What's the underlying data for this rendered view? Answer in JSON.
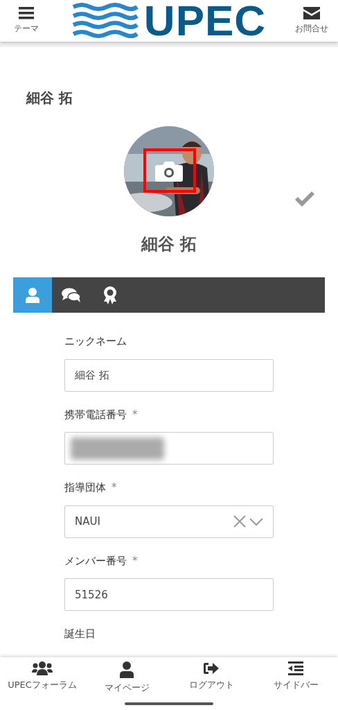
{
  "header": {
    "menu_label": "テーマ",
    "logo_text": "UPEC",
    "contact_label": "お問合せ"
  },
  "profile": {
    "title": "細谷 拓",
    "name": "細谷 拓",
    "saved": true,
    "photo_highlighted": true
  },
  "tabs": [
    {
      "kind": "profile",
      "selected": true
    },
    {
      "kind": "messages",
      "selected": false
    },
    {
      "kind": "awards",
      "selected": false
    }
  ],
  "fields": [
    {
      "kind": "text",
      "label": "ニックネーム",
      "value": "細谷 拓"
    },
    {
      "kind": "redacted",
      "label": "携帯電話番号",
      "required_mark": "*"
    },
    {
      "kind": "select",
      "label": "指導団体",
      "required_mark": "*",
      "value": "NAUI"
    },
    {
      "kind": "text",
      "label": "メンバー番号",
      "required_mark": "*",
      "value": "51526"
    },
    {
      "kind": "label",
      "label": "誕生日"
    }
  ],
  "bottom_nav": [
    {
      "kind": "group",
      "label": "UPECフォーラム"
    },
    {
      "kind": "user",
      "label": "マイページ"
    },
    {
      "kind": "logout",
      "label": "ログアウト"
    },
    {
      "kind": "sidebar",
      "label": "サイドバー"
    }
  ]
}
